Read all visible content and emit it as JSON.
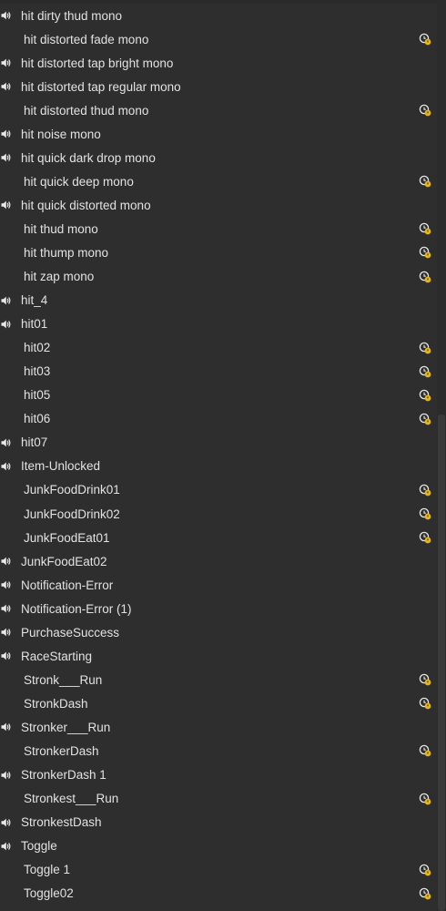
{
  "colors": {
    "background": "#2e2e2e",
    "text": "#e2e2e2",
    "sound_icon": "#e8e8e8",
    "status_icon_gold": "#e4b61a"
  },
  "icons": {
    "sound": "speaker-icon",
    "status": "clock-badge-icon"
  },
  "items": [
    {
      "label": "hit dirty thud mono",
      "sound": true,
      "status": false
    },
    {
      "label": "hit distorted fade mono",
      "sound": false,
      "status": true
    },
    {
      "label": "hit distorted tap bright mono",
      "sound": true,
      "status": false
    },
    {
      "label": "hit distorted tap regular mono",
      "sound": true,
      "status": false
    },
    {
      "label": "hit distorted thud mono",
      "sound": false,
      "status": true
    },
    {
      "label": "hit noise mono",
      "sound": true,
      "status": false
    },
    {
      "label": "hit quick dark drop mono",
      "sound": true,
      "status": false
    },
    {
      "label": "hit quick deep mono",
      "sound": false,
      "status": true
    },
    {
      "label": "hit quick distorted mono",
      "sound": true,
      "status": false
    },
    {
      "label": "hit thud mono",
      "sound": false,
      "status": true
    },
    {
      "label": "hit thump mono",
      "sound": false,
      "status": true
    },
    {
      "label": "hit zap mono",
      "sound": false,
      "status": true
    },
    {
      "label": "hit_4",
      "sound": true,
      "status": false
    },
    {
      "label": "hit01",
      "sound": true,
      "status": false
    },
    {
      "label": "hit02",
      "sound": false,
      "status": true
    },
    {
      "label": "hit03",
      "sound": false,
      "status": true
    },
    {
      "label": "hit05",
      "sound": false,
      "status": true
    },
    {
      "label": "hit06",
      "sound": false,
      "status": true
    },
    {
      "label": "hit07",
      "sound": true,
      "status": false
    },
    {
      "label": "Item-Unlocked",
      "sound": true,
      "status": false
    },
    {
      "label": "JunkFoodDrink01",
      "sound": false,
      "status": true
    },
    {
      "label": "JunkFoodDrink02",
      "sound": false,
      "status": true
    },
    {
      "label": "JunkFoodEat01",
      "sound": false,
      "status": true
    },
    {
      "label": "JunkFoodEat02",
      "sound": true,
      "status": false
    },
    {
      "label": "Notification-Error",
      "sound": true,
      "status": false
    },
    {
      "label": "Notification-Error (1)",
      "sound": true,
      "status": false
    },
    {
      "label": "PurchaseSuccess",
      "sound": true,
      "status": false
    },
    {
      "label": "RaceStarting",
      "sound": true,
      "status": false
    },
    {
      "label": "Stronk___Run",
      "sound": false,
      "status": true
    },
    {
      "label": "StronkDash",
      "sound": false,
      "status": true
    },
    {
      "label": "Stronker___Run",
      "sound": true,
      "status": false
    },
    {
      "label": "StronkerDash",
      "sound": false,
      "status": true
    },
    {
      "label": "StronkerDash 1",
      "sound": true,
      "status": false
    },
    {
      "label": "Stronkest___Run",
      "sound": false,
      "status": true
    },
    {
      "label": "StronkestDash",
      "sound": true,
      "status": false
    },
    {
      "label": "Toggle",
      "sound": true,
      "status": false
    },
    {
      "label": "Toggle 1",
      "sound": false,
      "status": true
    },
    {
      "label": "Toggle02",
      "sound": false,
      "status": true
    }
  ]
}
